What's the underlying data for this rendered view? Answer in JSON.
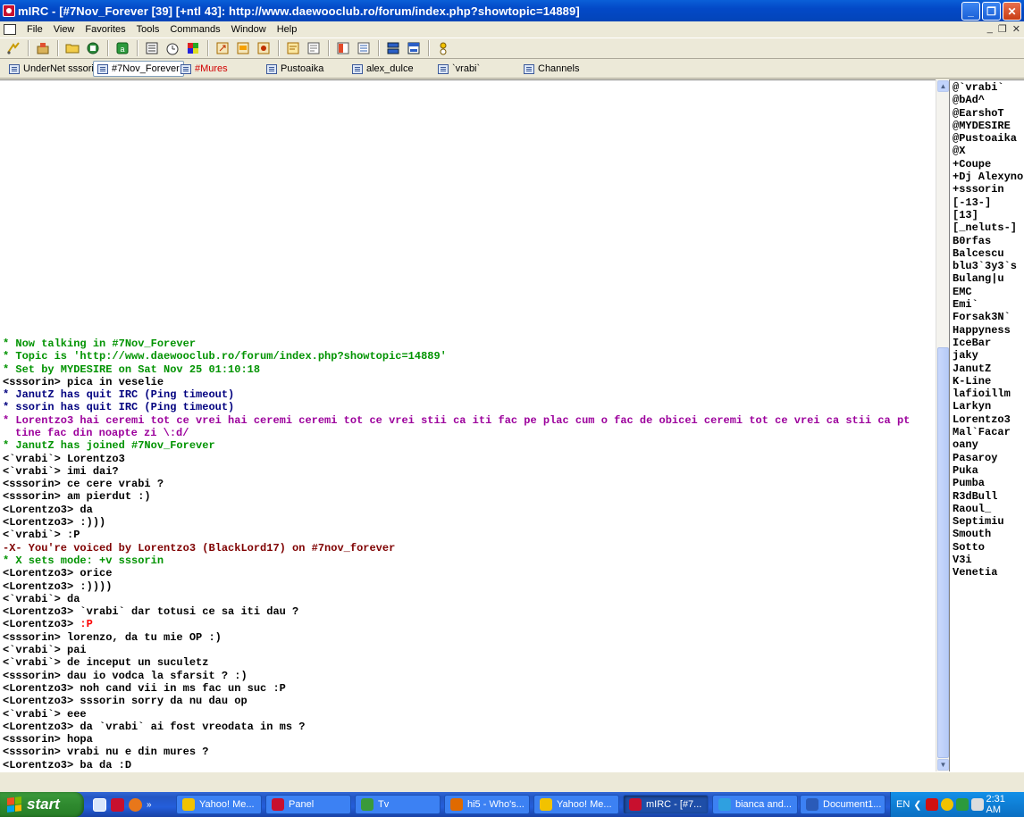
{
  "window": {
    "title": "mIRC - [#7Nov_Forever [39] [+ntl 43]: http://www.daewooclub.ro/forum/index.php?showtopic=14889]",
    "buttons": {
      "minimize": "_",
      "maximize": "❐",
      "close": "✕"
    }
  },
  "menu": {
    "items": [
      "File",
      "View",
      "Favorites",
      "Tools",
      "Commands",
      "Window",
      "Help"
    ],
    "mdi": {
      "minimize": "_",
      "restore": "❐",
      "close": "✕"
    }
  },
  "toolbar": {
    "icons": [
      "connect-icon",
      "options-icon",
      "folder-icon",
      "address-book-icon",
      "scripts-editor-icon",
      "channel-list-icon",
      "timer-icon",
      "colors-icon",
      "dcc-send-icon",
      "dcc-chat-icon",
      "dcc-options-icon",
      "log-icon",
      "notify-icon",
      "url-list-icon",
      "tile-horizontal-icon",
      "tile-vertical-icon",
      "about-icon"
    ]
  },
  "switchbar": {
    "tabs": [
      {
        "label": "UnderNet sssorin",
        "active": false,
        "alert": false
      },
      {
        "label": "#7Nov_Forever",
        "active": true,
        "alert": false
      },
      {
        "label": "#Mures",
        "active": false,
        "alert": true
      },
      {
        "label": "Pustoaika",
        "active": false,
        "alert": false
      },
      {
        "label": "alex_dulce",
        "active": false,
        "alert": false
      },
      {
        "label": "`vrabi`",
        "active": false,
        "alert": false
      },
      {
        "label": "Channels",
        "active": false,
        "alert": false
      }
    ]
  },
  "chat": {
    "lines": [
      {
        "text": "* Now talking in #7Nov_Forever",
        "color": "#009300"
      },
      {
        "text": "* Topic is 'http://www.daewooclub.ro/forum/index.php?showtopic=14889'",
        "color": "#009300"
      },
      {
        "text": "* Set by MYDESIRE on Sat Nov 25 01:10:18",
        "color": "#009300"
      },
      {
        "text": "<sssorin> pica in veselie",
        "color": "#000000"
      },
      {
        "text": "* JanutZ has quit IRC (Ping timeout)",
        "color": "#00007f"
      },
      {
        "text": "* ssorin has quit IRC (Ping timeout)",
        "color": "#00007f"
      },
      {
        "text": "* Lorentzo3 hai ceremi tot ce vrei hai ceremi ceremi tot ce vrei stii ca iti fac pe plac cum o fac de obicei ceremi tot ce vrei ca stii ca pt tine fac din noapte zi \\:d/",
        "color": "#9c009c"
      },
      {
        "text": "* JanutZ has joined #7Nov_Forever",
        "color": "#009300"
      },
      {
        "text": "<`vrabi`> Lorentzo3",
        "color": "#000000"
      },
      {
        "text": "<`vrabi`> imi dai?",
        "color": "#000000"
      },
      {
        "text": "<sssorin> ce cere vrabi ?",
        "color": "#000000"
      },
      {
        "text": "<sssorin> am pierdut :)",
        "color": "#000000"
      },
      {
        "text": "<Lorentzo3> da",
        "color": "#000000"
      },
      {
        "text": "<Lorentzo3> :)))",
        "color": "#000000"
      },
      {
        "text": "<`vrabi`> :P",
        "color": "#000000"
      },
      {
        "text": "-X- You're voiced by Lorentzo3 (BlackLord17) on #7nov_forever",
        "color": "#7f0000"
      },
      {
        "text": "* X sets mode: +v sssorin",
        "color": "#009300"
      },
      {
        "text": "<Lorentzo3> orice",
        "color": "#000000"
      },
      {
        "text": "<Lorentzo3> :))))",
        "color": "#000000"
      },
      {
        "text": "<`vrabi`> da",
        "color": "#000000"
      },
      {
        "text": "<Lorentzo3> `vrabi` dar totusi ce sa iti dau ?",
        "color": "#000000"
      },
      {
        "text": "<Lorentzo3> ",
        "suffix": ":P",
        "color": "#000000"
      },
      {
        "text": "<sssorin> lorenzo, da tu mie OP :)",
        "color": "#000000"
      },
      {
        "text": "<`vrabi`> pai",
        "color": "#000000"
      },
      {
        "text": "<`vrabi`> de inceput un suculetz",
        "color": "#000000"
      },
      {
        "text": "<sssorin> dau io vodca la sfarsit ? :)",
        "color": "#000000"
      },
      {
        "text": "<Lorentzo3> noh cand vii in ms fac un suc :P",
        "color": "#000000"
      },
      {
        "text": "<Lorentzo3> sssorin sorry da nu dau op",
        "color": "#000000"
      },
      {
        "text": "<`vrabi`> eee",
        "color": "#000000"
      },
      {
        "text": "<Lorentzo3> da `vrabi` ai fost vreodata in ms ?",
        "color": "#000000"
      },
      {
        "text": "<sssorin> hopa",
        "color": "#000000"
      },
      {
        "text": "<sssorin> vrabi nu e din mures ?",
        "color": "#000000"
      },
      {
        "text": "<Lorentzo3> ba da :D",
        "color": "#000000"
      }
    ],
    "highlight_color": "#fc0000"
  },
  "scrollbar": {
    "up": "▲",
    "down": "▼"
  },
  "nicklist": [
    "@`vrabi`",
    "@bAd^",
    "@EarshoT",
    "@MYDESIRE",
    "@Pustoaika",
    "@X",
    "+Coupe",
    "+Dj Alexyno",
    "+sssorin",
    "[-13-]",
    "[13]",
    "[_neluts-]",
    "B0rfas",
    "Balcescu",
    "blu3`3y3`s",
    "Bulang|u",
    "EMC",
    "Emi`",
    "Forsak3N`",
    "Happyness",
    "IceBar",
    "jaky",
    "JanutZ",
    "K-Line",
    "lafioillm",
    "Larkyn",
    "Lorentzo3",
    "Mal`Facar",
    "oany",
    "Pasaroy",
    "Puka",
    "Pumba",
    "R3dBull",
    "Raoul_",
    "Septimiu",
    "Smouth",
    "Sotto",
    "V3i",
    "Venetia"
  ],
  "taskbar": {
    "start_label": "start",
    "tasks": [
      {
        "label": "Yahoo! Me...",
        "icon_color": "#f2c200",
        "active": false
      },
      {
        "label": "Panel",
        "icon_color": "#c8102e",
        "active": false
      },
      {
        "label": "Tv",
        "icon_color": "#3a9a3a",
        "active": false
      },
      {
        "label": "hi5 - Who's...",
        "icon_color": "#e06a00",
        "active": false
      },
      {
        "label": "Yahoo! Me...",
        "icon_color": "#f2c200",
        "active": false
      },
      {
        "label": "mIRC - [#7...",
        "icon_color": "#c8102e",
        "active": true
      },
      {
        "label": "bianca and...",
        "icon_color": "#2fa0e0",
        "active": false
      },
      {
        "label": "Document1...",
        "icon_color": "#2a5bb8",
        "active": false
      }
    ],
    "tray": {
      "language": "EN",
      "clock": "2:31 AM"
    }
  }
}
